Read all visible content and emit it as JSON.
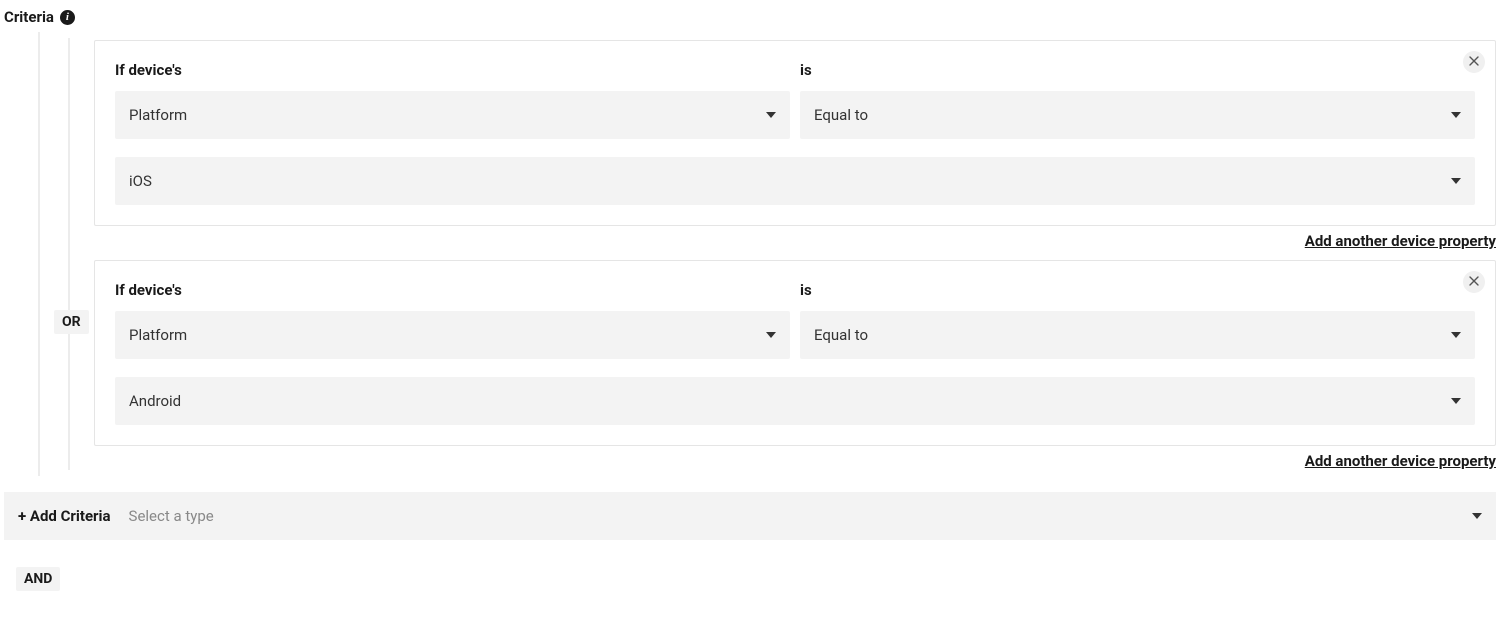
{
  "header": {
    "title": "Criteria"
  },
  "labels": {
    "if_devices": "If device's",
    "is": "is",
    "add_property": "Add another device property",
    "or": "OR",
    "and": "AND"
  },
  "rules": [
    {
      "property": "Platform",
      "operator": "Equal to",
      "value": "iOS"
    },
    {
      "property": "Platform",
      "operator": "Equal to",
      "value": "Android"
    }
  ],
  "footer": {
    "add_label": "+ Add Criteria",
    "placeholder": "Select a type"
  }
}
